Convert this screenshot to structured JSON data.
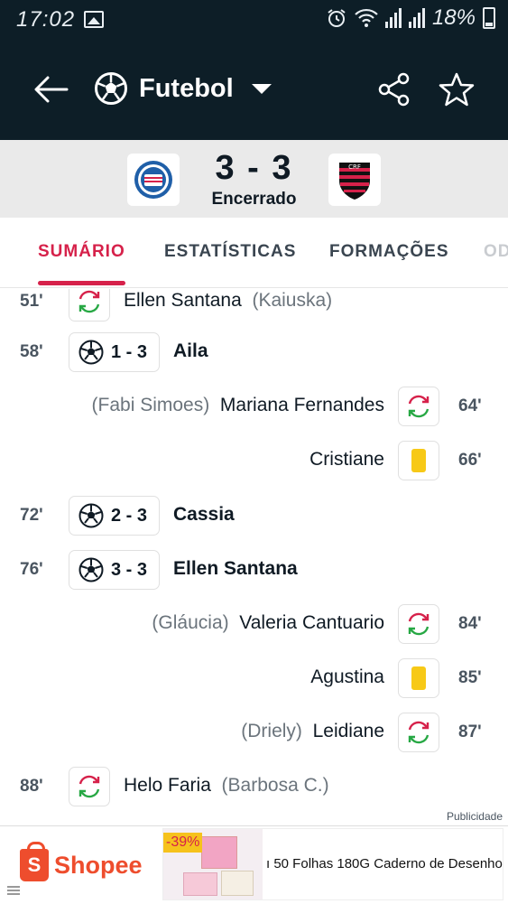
{
  "status_bar": {
    "time": "17:02",
    "battery": "18%"
  },
  "header": {
    "sport": "Futebol"
  },
  "match": {
    "score": "3 - 3",
    "status": "Encerrado"
  },
  "tabs": [
    "SUMÁRIO",
    "ESTATÍSTICAS",
    "FORMAÇÕES",
    "OD"
  ],
  "events": [
    {
      "minute": "51'",
      "type": "substitution",
      "side": "home",
      "player": "Ellen Santana",
      "sub": "(Kaiuska)"
    },
    {
      "minute": "58'",
      "type": "goal",
      "side": "home",
      "score": "1 - 3",
      "player": "Aila"
    },
    {
      "minute": "64'",
      "type": "substitution",
      "side": "away",
      "player": "Mariana Fernandes",
      "sub": "(Fabi Simoes)"
    },
    {
      "minute": "66'",
      "type": "yellow-card",
      "side": "away",
      "player": "Cristiane"
    },
    {
      "minute": "72'",
      "type": "goal",
      "side": "home",
      "score": "2 - 3",
      "player": "Cassia"
    },
    {
      "minute": "76'",
      "type": "goal",
      "side": "home",
      "score": "3 - 3",
      "player": "Ellen Santana"
    },
    {
      "minute": "84'",
      "type": "substitution",
      "side": "away",
      "player": "Valeria Cantuario",
      "sub": "(Gláucia)"
    },
    {
      "minute": "85'",
      "type": "yellow-card",
      "side": "away",
      "player": "Agustina"
    },
    {
      "minute": "87'",
      "type": "substitution",
      "side": "away",
      "player": "Leidiane",
      "sub": "(Driely)"
    },
    {
      "minute": "88'",
      "type": "substitution",
      "side": "home",
      "player": "Helo Faria",
      "sub": "(Barbosa C.)"
    }
  ],
  "ad": {
    "label": "Publicidade",
    "brand": "Shopee",
    "discount": "-39%",
    "product": "ı 50 Folhas 180G Caderno de Desenho"
  },
  "colors": {
    "header_bg": "#0d1e27",
    "accent": "#d6214a",
    "yellow_card": "#f7c917",
    "shopee": "#ee4d2d"
  }
}
